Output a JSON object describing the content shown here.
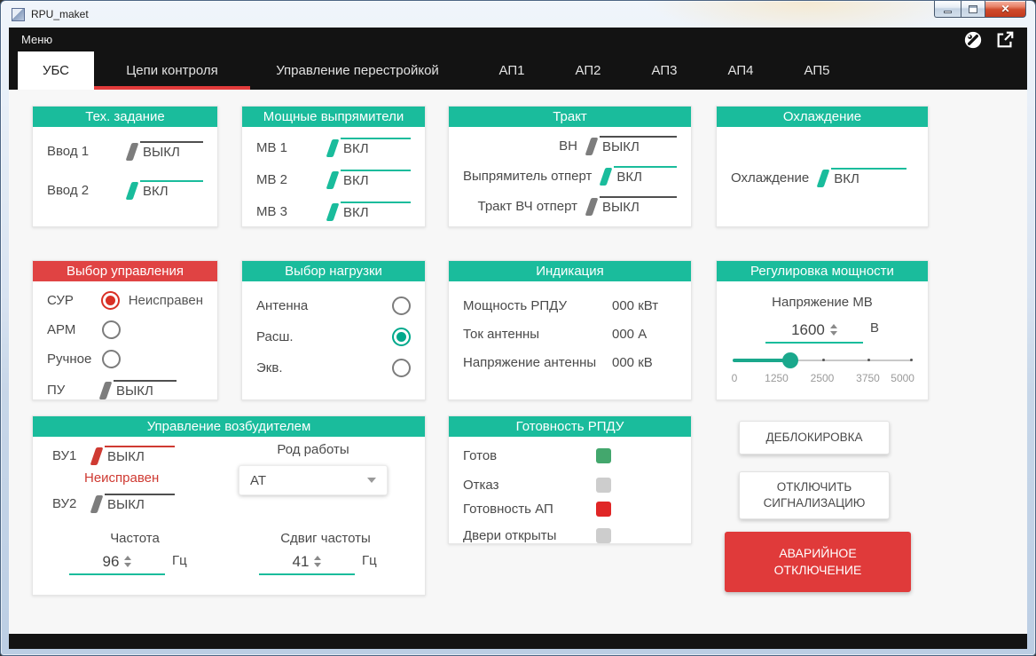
{
  "window": {
    "title": "RPU_maket",
    "caption_icons": [
      "minimize-icon",
      "maximize-icon",
      "close-icon"
    ]
  },
  "menubar": {
    "menu_label": "Меню",
    "icons": [
      "wrench-circle-icon",
      "open-external-icon"
    ]
  },
  "tabs": {
    "items": [
      {
        "label": "УБС",
        "active": true
      },
      {
        "label": "Цепи контроля",
        "underlined": true
      },
      {
        "label": "Управление перестройкой"
      },
      {
        "label": "АП1"
      },
      {
        "label": "АП2"
      },
      {
        "label": "АП3"
      },
      {
        "label": "АП4"
      },
      {
        "label": "АП5"
      }
    ]
  },
  "colors": {
    "accent_teal": "#1abc9c",
    "alert_red": "#e04343",
    "fault_red": "#cf3a32",
    "ok_green": "#43a76d",
    "off_gray": "#cdcdcd",
    "indicator_red": "#e02626",
    "tab_underline": "#e23b3b"
  },
  "panels": {
    "tech": {
      "title": "Тех. задание",
      "rows": [
        {
          "label": "Ввод 1",
          "state": "ВЫКЛ"
        },
        {
          "label": "Ввод 2",
          "state": "ВКЛ"
        }
      ]
    },
    "rectifiers": {
      "title": "Мощные выпрямители",
      "rows": [
        {
          "label": "МВ 1",
          "state": "ВКЛ"
        },
        {
          "label": "МВ 2",
          "state": "ВКЛ"
        },
        {
          "label": "МВ 3",
          "state": "ВКЛ"
        }
      ]
    },
    "tract": {
      "title": "Тракт",
      "rows": [
        {
          "label": "ВН",
          "state": "ВЫКЛ"
        },
        {
          "label": "Выпрямитель отперт",
          "state": "ВКЛ"
        },
        {
          "label": "Тракт ВЧ отперт",
          "state": "ВЫКЛ"
        }
      ]
    },
    "cooling": {
      "title": "Охлаждение",
      "rows": [
        {
          "label": "Охлаждение",
          "state": "ВКЛ"
        }
      ]
    },
    "control_select": {
      "title": "Выбор управления",
      "options": [
        {
          "label": "СУР",
          "note": "Неисправен",
          "selected": true
        },
        {
          "label": "АРМ"
        },
        {
          "label": "Ручное"
        }
      ],
      "toggle": {
        "label": "ПУ",
        "state": "ВЫКЛ"
      }
    },
    "load_select": {
      "title": "Выбор нагрузки",
      "options": [
        {
          "label": "Антенна"
        },
        {
          "label": "Расш.",
          "selected": true
        },
        {
          "label": "Экв."
        }
      ]
    },
    "indication": {
      "title": "Индикация",
      "rows": [
        {
          "label": "Мощность РПДУ",
          "value": "000 кВт"
        },
        {
          "label": "Ток антенны",
          "value": "000 А"
        },
        {
          "label": "Напряжение антенны",
          "value": "000 кВ"
        }
      ]
    },
    "power_reg": {
      "title": "Регулировка мощности",
      "field_label": "Напряжение МВ",
      "value": "1600",
      "unit": "В",
      "slider": {
        "min": 0,
        "max": 5000,
        "value": 1600,
        "ticks": [
          "0",
          "1250",
          "2500",
          "3750",
          "5000"
        ]
      }
    },
    "exciter": {
      "title": "Управление возбудителем",
      "vu1": {
        "label": "ВУ1",
        "state": "ВЫКЛ",
        "note": "Неисправен"
      },
      "vu2": {
        "label": "ВУ2",
        "state": "ВЫКЛ"
      },
      "mode": {
        "label": "Род работы",
        "value": "АТ"
      },
      "freq": {
        "label": "Частота",
        "value": "96",
        "unit": "Гц"
      },
      "shift": {
        "label": "Сдвиг частоты",
        "value": "41",
        "unit": "Гц"
      }
    },
    "readiness": {
      "title": "Готовность РПДУ",
      "rows": [
        {
          "label": "Готов",
          "status": "green"
        },
        {
          "label": "Отказ",
          "status": "gray"
        },
        {
          "label": "Готовность АП",
          "status": "red"
        },
        {
          "label": "Двери открыты",
          "status": "gray"
        }
      ]
    }
  },
  "buttons": {
    "unlock": "ДЕБЛОКИРОВКА",
    "mute": "ОТКЛЮЧИТЬ СИГНАЛИЗАЦИЮ",
    "emergency": "АВАРИЙНОЕ ОТКЛЮЧЕНИЕ"
  }
}
